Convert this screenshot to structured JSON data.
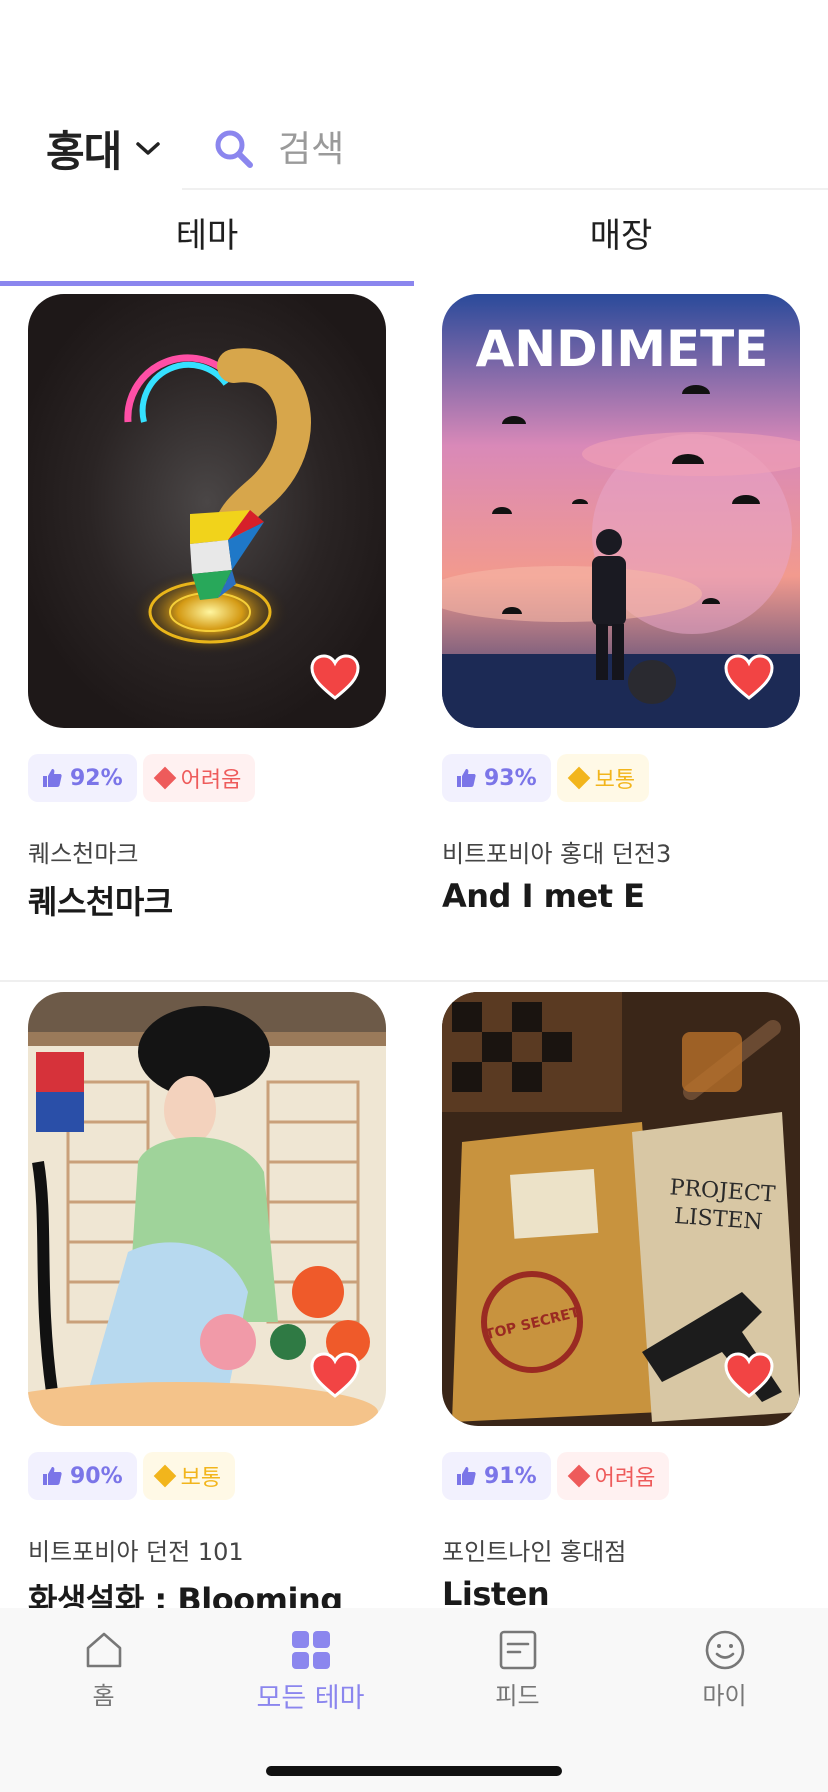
{
  "header": {
    "region": "홍대",
    "search_placeholder": "검색"
  },
  "tabs": [
    {
      "label": "테마",
      "active": true
    },
    {
      "label": "매장",
      "active": false
    }
  ],
  "themes": [
    {
      "store": "퀘스천마크",
      "title": "퀘스천마크",
      "like": "92%",
      "difficulty": "어려움",
      "difficulty_level": "hard",
      "favorited": true
    },
    {
      "store": "비트포비아 홍대 던전3",
      "title": "And I met E",
      "like": "93%",
      "difficulty": "보통",
      "difficulty_level": "normal",
      "favorited": true
    },
    {
      "store": "비트포비아 던전 101",
      "title": "화생설화 : Blooming",
      "like": "90%",
      "difficulty": "보통",
      "difficulty_level": "normal",
      "favorited": true
    },
    {
      "store": "포인트나인 홍대점",
      "title": "Listen",
      "like": "91%",
      "difficulty": "어려움",
      "difficulty_level": "hard",
      "favorited": true
    }
  ],
  "posters": {
    "and_i_met_e_text": "ANDIMETE",
    "listen_text_1": "PROJECT",
    "listen_text_2": "LISTEN",
    "listen_stamp": "TOP SECRET"
  },
  "nav": [
    {
      "label": "홈",
      "icon": "home-icon",
      "active": false
    },
    {
      "label": "모든 테마",
      "icon": "grid-icon",
      "active": true
    },
    {
      "label": "피드",
      "icon": "feed-icon",
      "active": false
    },
    {
      "label": "마이",
      "icon": "smile-icon",
      "active": false
    }
  ],
  "colors": {
    "accent": "#8b86ee",
    "hard": "#ee5b5b",
    "normal": "#f2b51c",
    "heart": "#f24444"
  }
}
